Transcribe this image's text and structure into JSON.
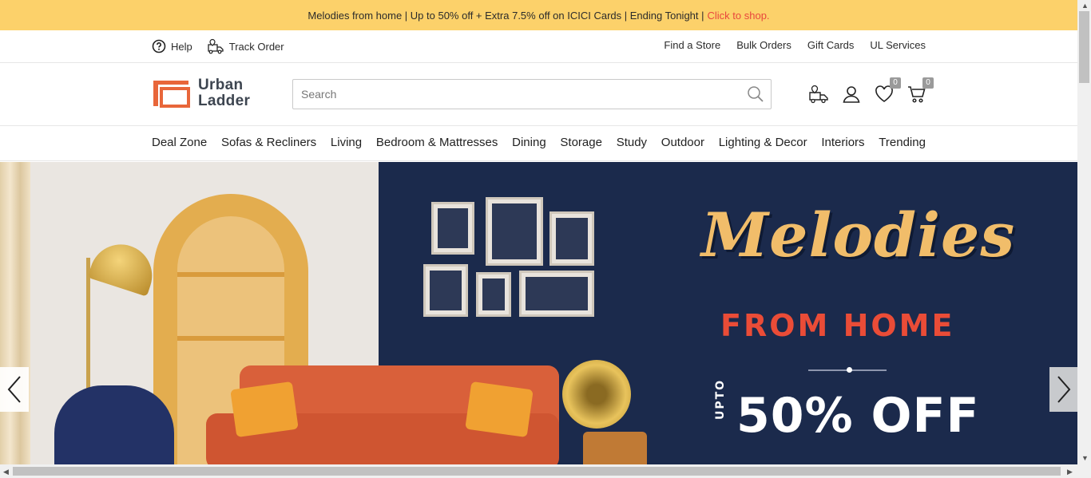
{
  "promo": {
    "text": "Melodies from home | Up to 50% off + Extra 7.5% off on ICICI Cards | Ending Tonight |",
    "cta": "Click to shop.",
    "bg_color": "#fcd16a",
    "cta_color": "#e8473d"
  },
  "utility": {
    "help": "Help",
    "track_order": "Track Order",
    "links": [
      "Find a Store",
      "Bulk Orders",
      "Gift Cards",
      "UL Services"
    ]
  },
  "logo": {
    "line1": "Urban",
    "line2": "Ladder",
    "brand_color": "#e8663a"
  },
  "search": {
    "placeholder": "Search",
    "value": ""
  },
  "header_icons": {
    "store_locator": "truck-location-icon",
    "account": "user-icon",
    "wishlist": "heart-icon",
    "wishlist_count": "0",
    "cart": "cart-icon",
    "cart_count": "0"
  },
  "categories": [
    "Deal Zone",
    "Sofas & Recliners",
    "Living",
    "Bedroom & Mattresses",
    "Dining",
    "Storage",
    "Study",
    "Outdoor",
    "Lighting & Decor",
    "Interiors",
    "Trending"
  ],
  "hero": {
    "title": "Melodies",
    "subtitle": "FROM HOME",
    "upto": "UPTO",
    "offer": "50% OFF",
    "bg_color": "#1b2a4c",
    "accent_gold": "#f1bd6a",
    "accent_red": "#ea4c37"
  }
}
